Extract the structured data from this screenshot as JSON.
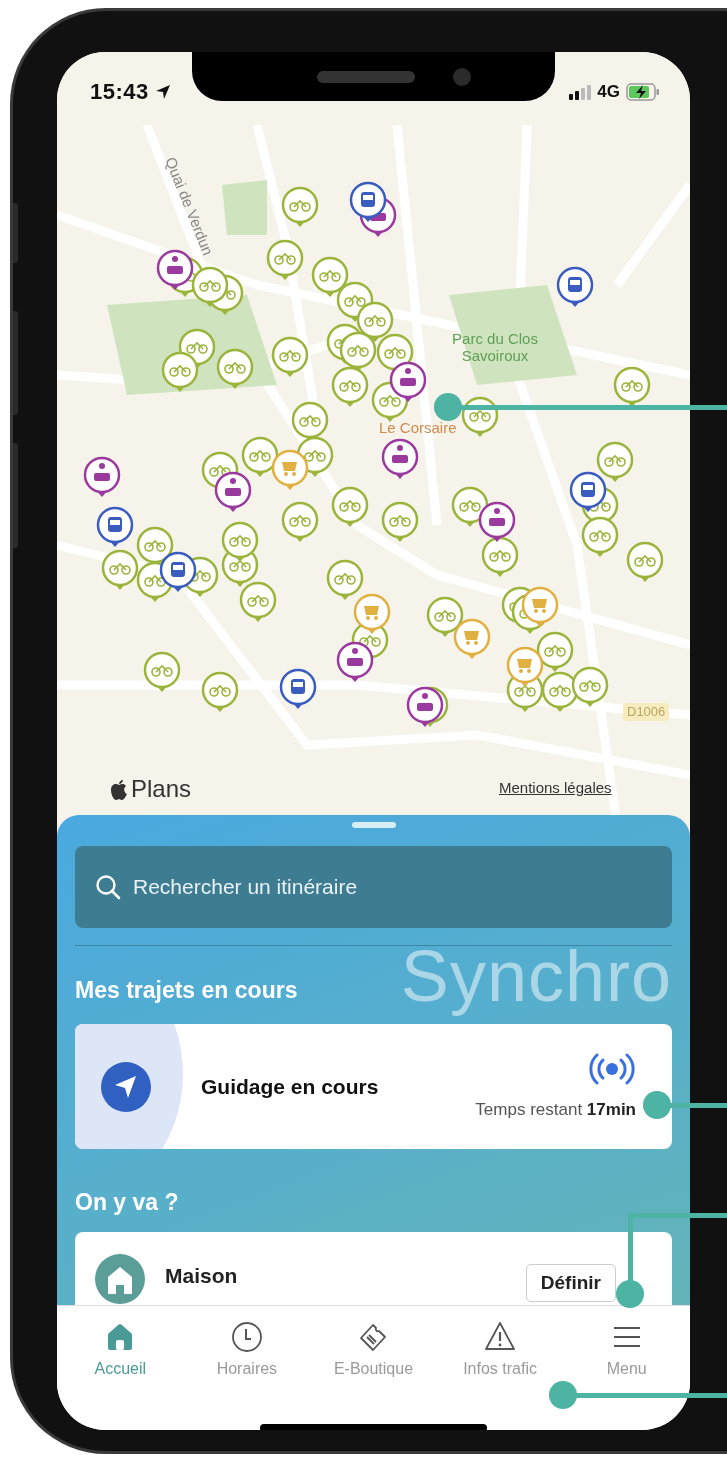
{
  "status_bar": {
    "time": "15:43",
    "network": "4G"
  },
  "map": {
    "labels": [
      {
        "text": "Quai de Verdun",
        "kind": "street"
      },
      {
        "text": "Parc du Clos Savoiroux",
        "kind": "park"
      },
      {
        "text": "Le Corsaire",
        "kind": "place"
      },
      {
        "text": "D1006",
        "kind": "road-number"
      }
    ],
    "brand": "Plans",
    "legal_link": "Mentions légales"
  },
  "sheet": {
    "search": {
      "placeholder": "Rechercher un itinéraire"
    },
    "watermark": "Synchro",
    "current_trips": {
      "title": "Mes trajets en cours",
      "trip": {
        "title": "Guidage en cours",
        "remaining": "Temps restant **17min**"
      }
    },
    "destinations": {
      "title": "On y va ?",
      "items": [
        {
          "name": "Maison",
          "action": "Définir"
        }
      ]
    }
  },
  "tab_bar": [
    {
      "label": "Accueil",
      "selected": true
    },
    {
      "label": "Horaires",
      "selected": false
    },
    {
      "label": "E-Boutique",
      "selected": false
    },
    {
      "label": "Infos trafic",
      "selected": false
    },
    {
      "label": "Menu",
      "selected": false
    }
  ]
}
